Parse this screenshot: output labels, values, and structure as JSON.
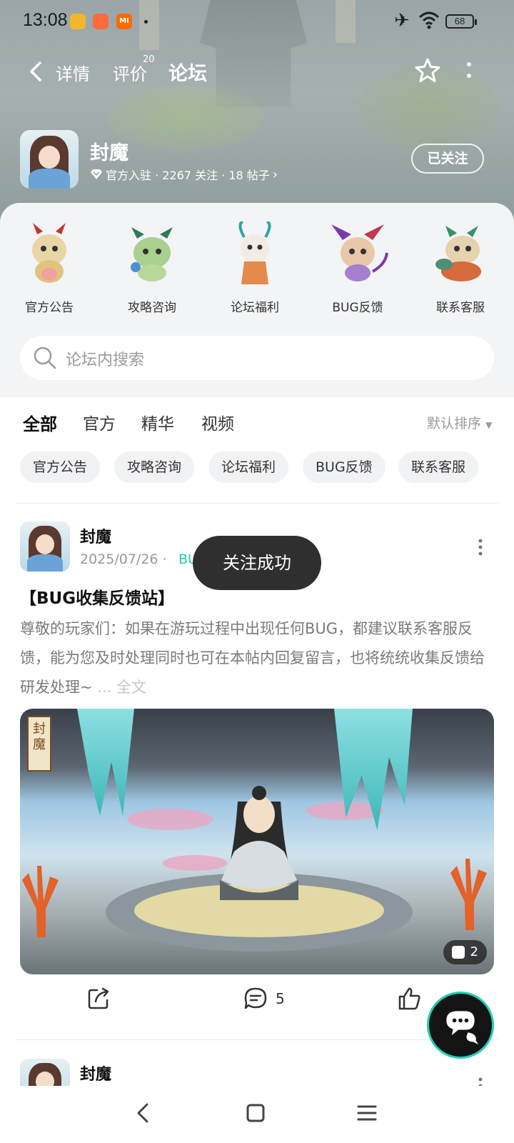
{
  "status_bar": {
    "time": "13:08",
    "battery": "68",
    "icons": [
      "weibo-icon",
      "shop-icon",
      "mi-icon",
      "airplane-icon",
      "wifi-icon",
      "battery-icon"
    ],
    "mi_label": "MI"
  },
  "nav": {
    "tabs": [
      {
        "label": "详情"
      },
      {
        "label": "评价",
        "badge": "20"
      },
      {
        "label": "论坛",
        "active": true
      }
    ]
  },
  "game": {
    "name": "封魔",
    "meta": "官方入驻 · 2267 关注 · 18 帖子",
    "follow_label": "已关注"
  },
  "categories": [
    {
      "label": "官方公告"
    },
    {
      "label": "攻略咨询"
    },
    {
      "label": "论坛福利"
    },
    {
      "label": "BUG反馈"
    },
    {
      "label": "联系客服"
    }
  ],
  "search": {
    "placeholder": "论坛内搜索"
  },
  "filter_tabs": [
    {
      "label": "全部",
      "active": true
    },
    {
      "label": "官方"
    },
    {
      "label": "精华"
    },
    {
      "label": "视频"
    }
  ],
  "sort_label": "默认排序",
  "chips": [
    {
      "label": "官方公告"
    },
    {
      "label": "攻略咨询"
    },
    {
      "label": "论坛福利"
    },
    {
      "label": "BUG反馈"
    },
    {
      "label": "联系客服"
    }
  ],
  "post": {
    "author": "封魔",
    "date": "2025/07/26 ·",
    "tag_fragment": "BU",
    "title": "【BUG收集反馈站】",
    "body": "尊敬的玩家们：如果在游玩过程中出现任何BUG，都建议联系客服反馈，能为您及时处理同时也可在本帖内回复留言，也将统统收集反馈给研发处理~",
    "more_label": "... 全文",
    "image_count": "2",
    "image_seal": "封魔",
    "comment_count": "5"
  },
  "next_post": {
    "author": "封魔"
  },
  "toast": "关注成功",
  "colors": {
    "accent": "#1fcfb4",
    "toast_bg": "#2f2f2f"
  }
}
